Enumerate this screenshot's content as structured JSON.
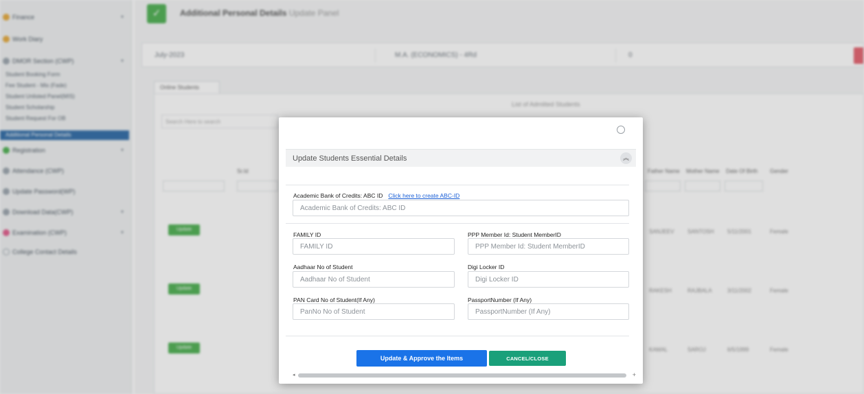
{
  "background": {
    "sidebar": {
      "items": [
        {
          "label": "Finance",
          "color": "#e5a83b"
        },
        {
          "label": "Work Diary",
          "color": "#e5a83b"
        },
        {
          "label": "DMOR Section (CWP)",
          "color": "#9aa4ad"
        }
      ],
      "subitems": [
        "Student Booking Form",
        "Fee Student - Mis (Fade)",
        "Student Unlisted Panel(MIS)",
        "Student Scholarship",
        "Student Request For OB",
        "Additional Personal Details"
      ],
      "items2": [
        {
          "label": "Registration",
          "color": "#4caf50"
        },
        {
          "label": "Attendance (CWP)",
          "color": "#9aa4ad"
        },
        {
          "label": "Update Password(WP)",
          "color": "#9aa4ad"
        },
        {
          "label": "Download Data(CWP)",
          "color": "#9aa4ad"
        },
        {
          "label": "Examination (CWP)",
          "color": "#e05b8b"
        },
        {
          "label": "College Contact Details",
          "color": "#9aa4ad"
        }
      ]
    },
    "header": {
      "title": "Additional Personal Details",
      "subtitle": "Update Panel"
    },
    "filters": [
      "July-2023",
      "M.A. (ECONOMICS) - 4Rd",
      "0"
    ],
    "tab": "Online Students",
    "card_header": "List of Admitted Students",
    "search_placeholder": "Search Here to search",
    "columns": [
      "Sr.Id",
      "Father Name",
      "Mother Name",
      "Date Of Birth",
      "Gender"
    ],
    "row_button": "Update",
    "rows": [
      {
        "father": "SANJEEV",
        "mother": "SANTOSH",
        "dob": "5/11/2001",
        "gender": "Female"
      },
      {
        "father": "RAKESH",
        "mother": "RAJBALA",
        "dob": "3/11/2002",
        "gender": "Female"
      },
      {
        "father": "KAMAL",
        "mother": "SAROJ",
        "dob": "6/5/1999",
        "gender": "Female"
      }
    ]
  },
  "modal": {
    "panel_title": "Update Students Essential Details",
    "abc": {
      "label": "Academic Bank of Credits: ABC ID",
      "link": "Click here to create ABC-ID",
      "placeholder": "Academic Bank of Credits: ABC ID"
    },
    "family": {
      "label": "FAMILY ID",
      "placeholder": "FAMILY ID"
    },
    "ppp": {
      "label": "PPP Member Id: Student MemberID",
      "placeholder": "PPP Member Id: Student MemberID"
    },
    "aadhaar": {
      "label": "Aadhaar No of Student",
      "placeholder": "Aadhaar No of Student"
    },
    "digi": {
      "label": "Digi Locker ID",
      "placeholder": "Digi Locker ID"
    },
    "pan": {
      "label": "PAN Card No of Student(If Any)",
      "placeholder": "PanNo No of Student"
    },
    "passport": {
      "label": "PassportNumber (If Any)",
      "placeholder": "PassportNumber (If Any)"
    },
    "buttons": {
      "update": "Update & Approve the Items",
      "cancel": "CANCEL/CLOSE"
    },
    "colors": {
      "update": "#1a73e8",
      "cancel": "#1aa07a"
    }
  }
}
